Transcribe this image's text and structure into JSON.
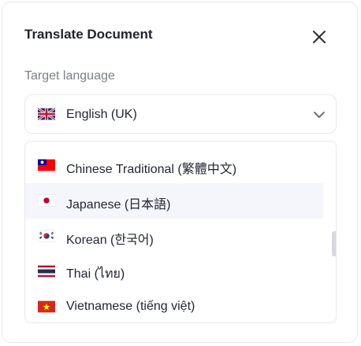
{
  "dialog": {
    "title": "Translate Document",
    "close_icon": "close-icon"
  },
  "field": {
    "label": "Target language",
    "selected": {
      "label": "English (UK)",
      "flag_icon": "flag-uk-icon"
    },
    "chevron_icon": "chevron-down-icon"
  },
  "options": [
    {
      "label": "Chinese Traditional (繁體中文)",
      "flag_icon": "flag-taiwan-icon",
      "highlighted": false
    },
    {
      "label": "Japanese (日本語)",
      "flag_icon": "flag-japan-icon",
      "highlighted": true
    },
    {
      "label": "Korean (한국어)",
      "flag_icon": "flag-korea-icon",
      "highlighted": false
    },
    {
      "label": "Thai (ไทย)",
      "flag_icon": "flag-thailand-icon",
      "highlighted": false
    },
    {
      "label": "Vietnamese (tiếng việt)",
      "flag_icon": "flag-vietnam-icon",
      "highlighted": false
    }
  ],
  "colors": {
    "highlight_bg": "#f5f6fb",
    "border": "#e6e8ec",
    "label_gray": "#7a7f8a"
  }
}
